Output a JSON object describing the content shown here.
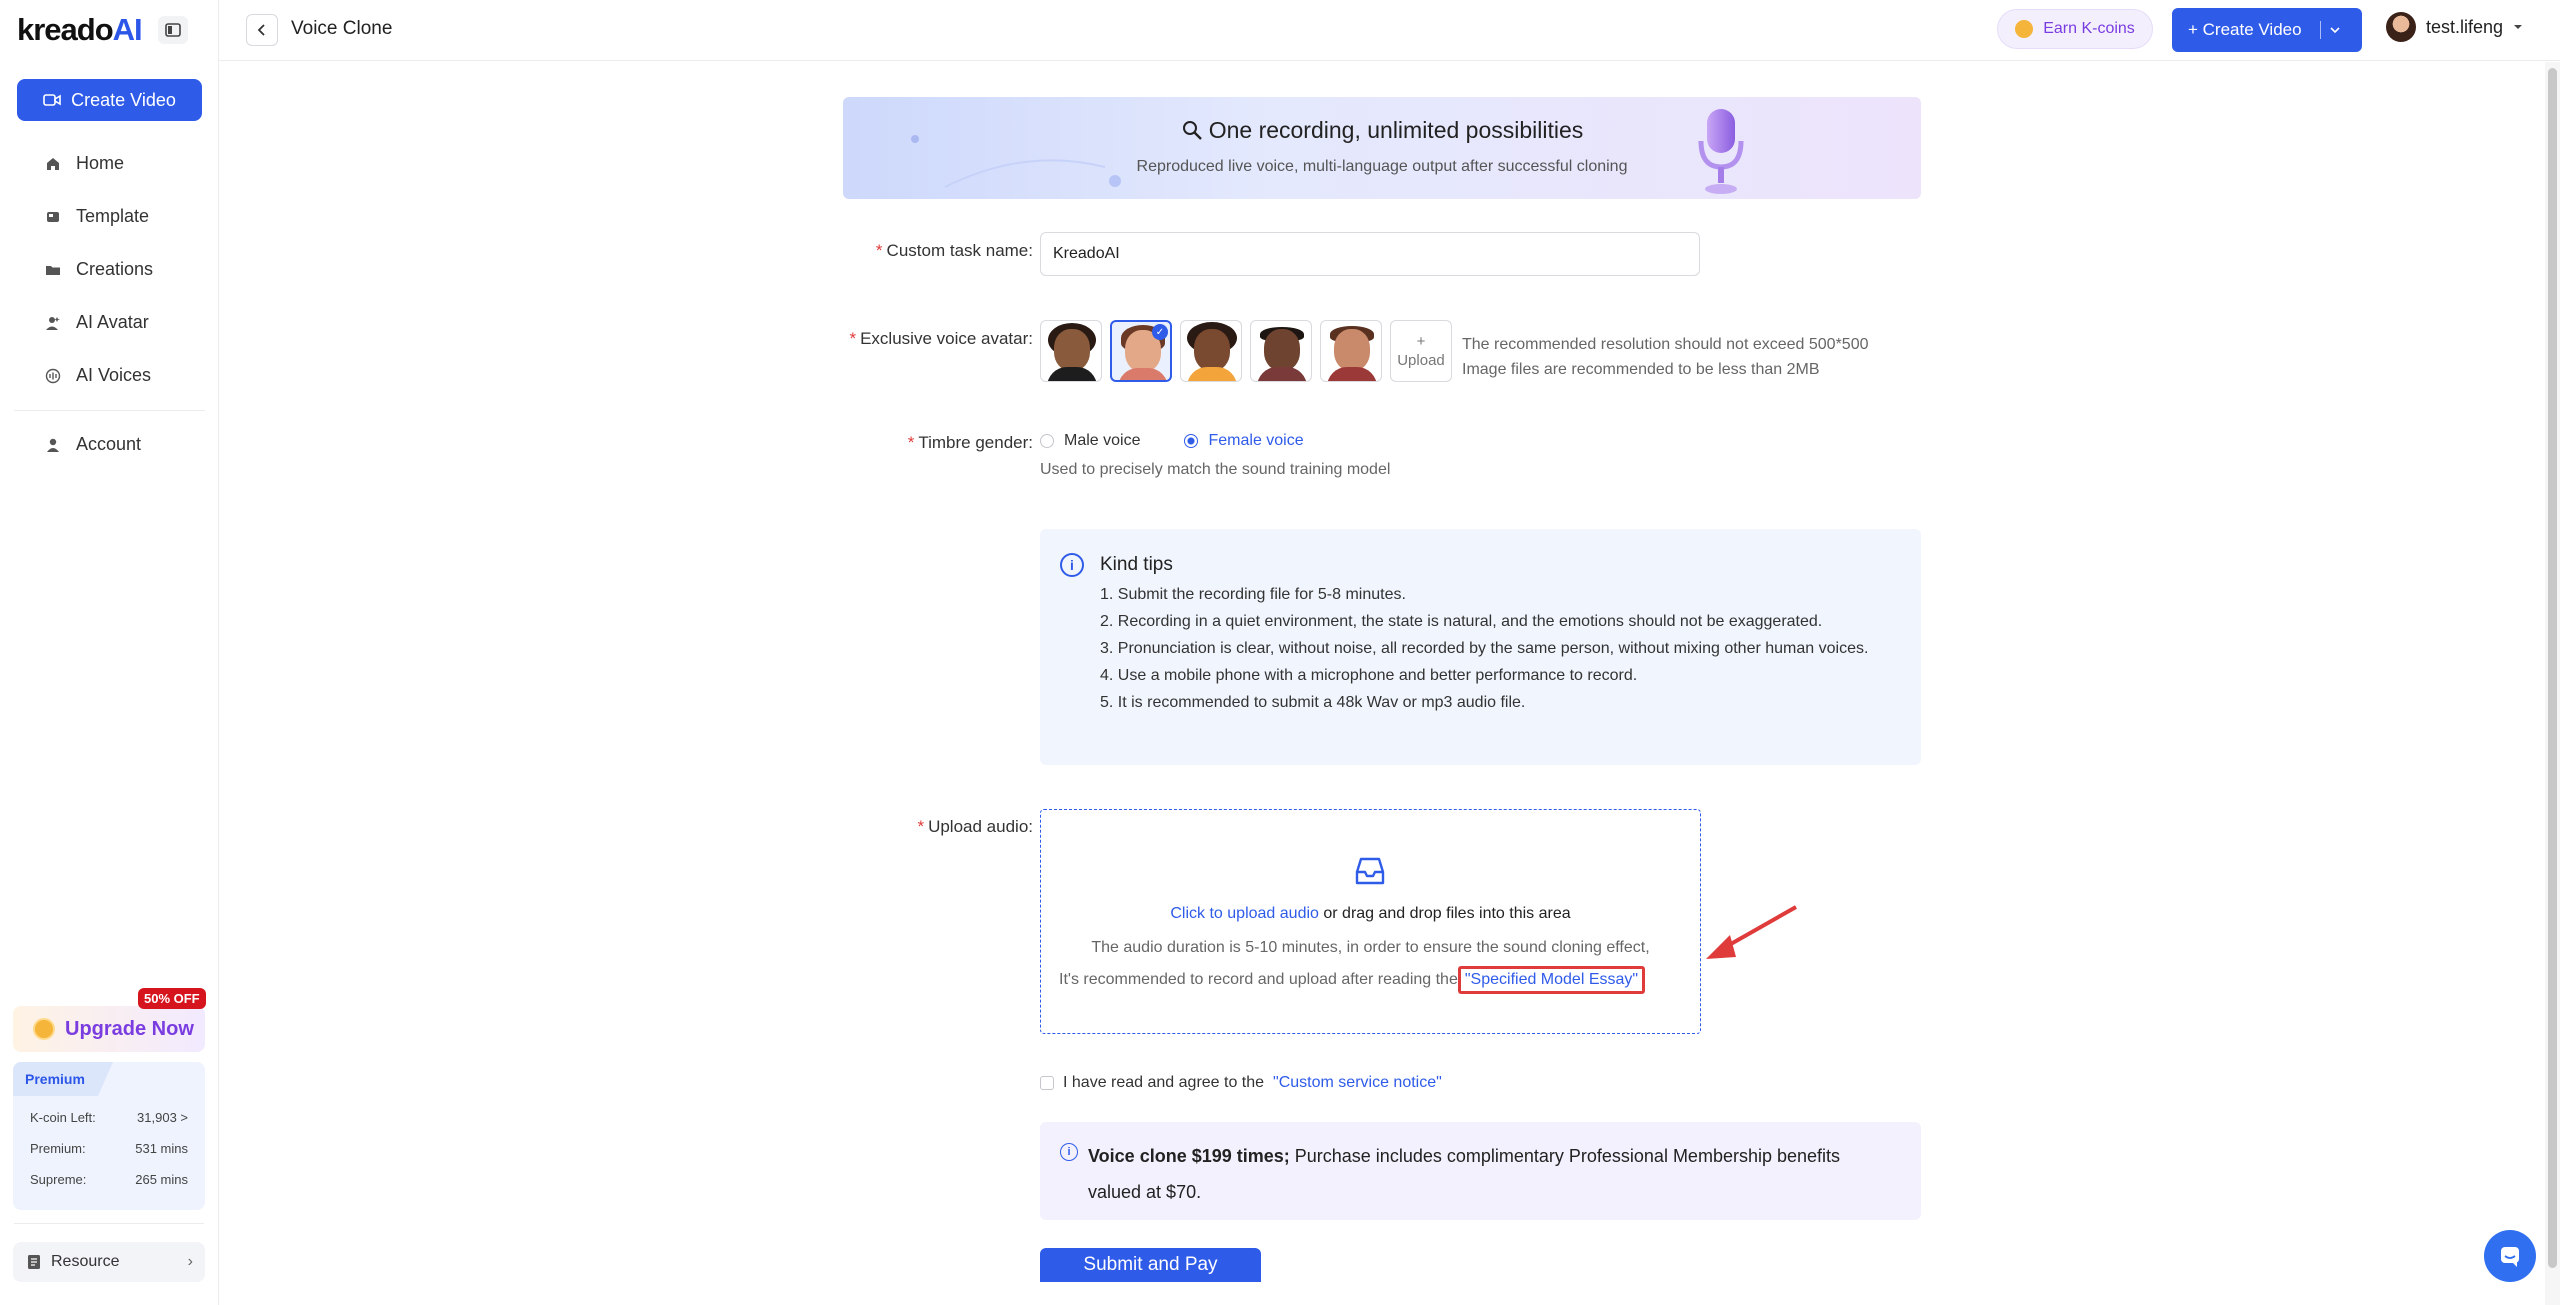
{
  "sidebar": {
    "logo_main": "kreado",
    "logo_ai": "AI",
    "create_video": "Create Video",
    "items": [
      {
        "label": "Home",
        "icon": "home-icon"
      },
      {
        "label": "Template",
        "icon": "template-icon"
      },
      {
        "label": "Creations",
        "icon": "folder-icon"
      },
      {
        "label": "AI Avatar",
        "icon": "avatar-icon"
      },
      {
        "label": "AI Voices",
        "icon": "voice-icon"
      },
      {
        "label": "Account",
        "icon": "user-icon"
      }
    ],
    "upgrade_label": "Upgrade Now",
    "discount_badge": "50% OFF",
    "plan": {
      "tab": "Premium",
      "rows": [
        {
          "label": "K-coin Left:",
          "value": "31,903 >"
        },
        {
          "label": "Premium:",
          "value": "531 mins"
        },
        {
          "label": "Supreme:",
          "value": "265 mins"
        }
      ]
    },
    "resource": "Resource"
  },
  "topbar": {
    "title": "Voice Clone",
    "earn": "Earn K-coins",
    "create_video": "+ Create Video",
    "username": "test.lifeng"
  },
  "banner": {
    "title": "One recording, unlimited possibilities",
    "subtitle": "Reproduced live voice, multi-language output after successful cloning"
  },
  "form": {
    "task_name_label": "Custom task name:",
    "task_name_value": "KreadoAI",
    "avatar_label": "Exclusive voice avatar:",
    "upload_plus": "+",
    "upload_label": "Upload",
    "avatar_hint_1": "The recommended resolution should not exceed 500*500",
    "avatar_hint_2": "Image files are recommended to be less than 2MB",
    "gender_label": "Timbre gender:",
    "male": "Male voice",
    "female": "Female voice",
    "gender_hint": "Used to precisely match the sound training model",
    "upload_audio_label": "Upload audio:"
  },
  "tips": {
    "title": "Kind tips",
    "items": [
      "1. Submit the recording file for 5-8 minutes.",
      "2. Recording in a quiet environment, the state is natural, and the emotions should not be exaggerated.",
      "3. Pronunciation is clear, without noise, all recorded by the same person, without mixing other human voices.",
      "4. Use a mobile phone with a microphone and better performance to record.",
      "5. It is recommended to submit a 48k Wav or mp3 audio file."
    ]
  },
  "dropzone": {
    "link": "Click to upload audio",
    "text": " or drag and drop files into this area",
    "line2": "The audio duration is 5-10 minutes, in order to ensure the sound cloning effect,",
    "line3": "It's recommended to record and upload after reading the",
    "essay": "\"Specified Model Essay\""
  },
  "agree": {
    "text": "I have read and agree to the",
    "link": "\"Custom service notice\""
  },
  "price": {
    "bold": "Voice clone $199 times;",
    "text": " Purchase includes complimentary Professional Membership benefits valued at $70."
  },
  "submit": "Submit and Pay"
}
